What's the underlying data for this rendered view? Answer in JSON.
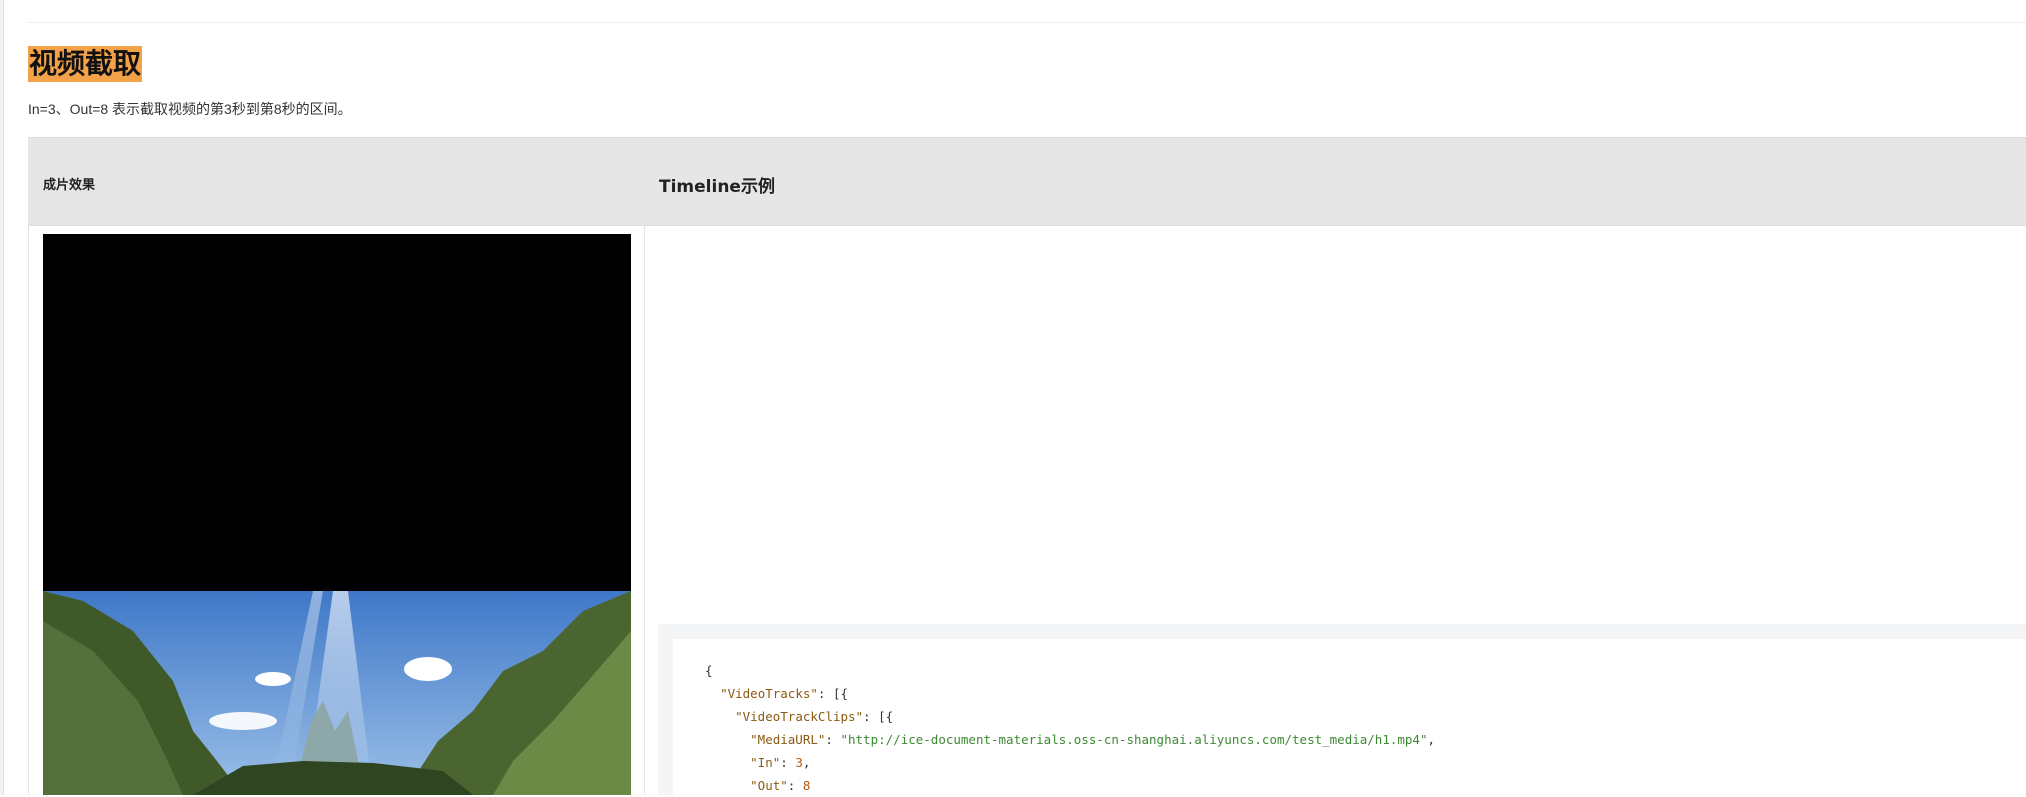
{
  "heading": "视频截取",
  "description": "In=3、Out=8 表示截取视频的第3秒到第8秒的区间。",
  "table": {
    "header_result": "成片效果",
    "header_timeline": "Timeline示例"
  },
  "code": {
    "line1_brace": "{",
    "video_tracks_key": "\"VideoTracks\"",
    "video_tracks_tail": ": [{",
    "clips_key": "\"VideoTrackClips\"",
    "clips_tail": ": [{",
    "media_url_key": "\"MediaURL\"",
    "media_url_value": "\"http://ice-document-materials.oss-cn-shanghai.aliyuncs.com/test_media/h1.mp4\"",
    "in_key": "\"In\"",
    "in_value": "3",
    "out_key": "\"Out\"",
    "out_value": "8"
  },
  "colors": {
    "heading_highlight": "#f4a24a",
    "table_header_bg": "#e6e6e6",
    "code_key": "#8a5b11",
    "code_string": "#3d8a33",
    "code_number": "#b35a14"
  }
}
